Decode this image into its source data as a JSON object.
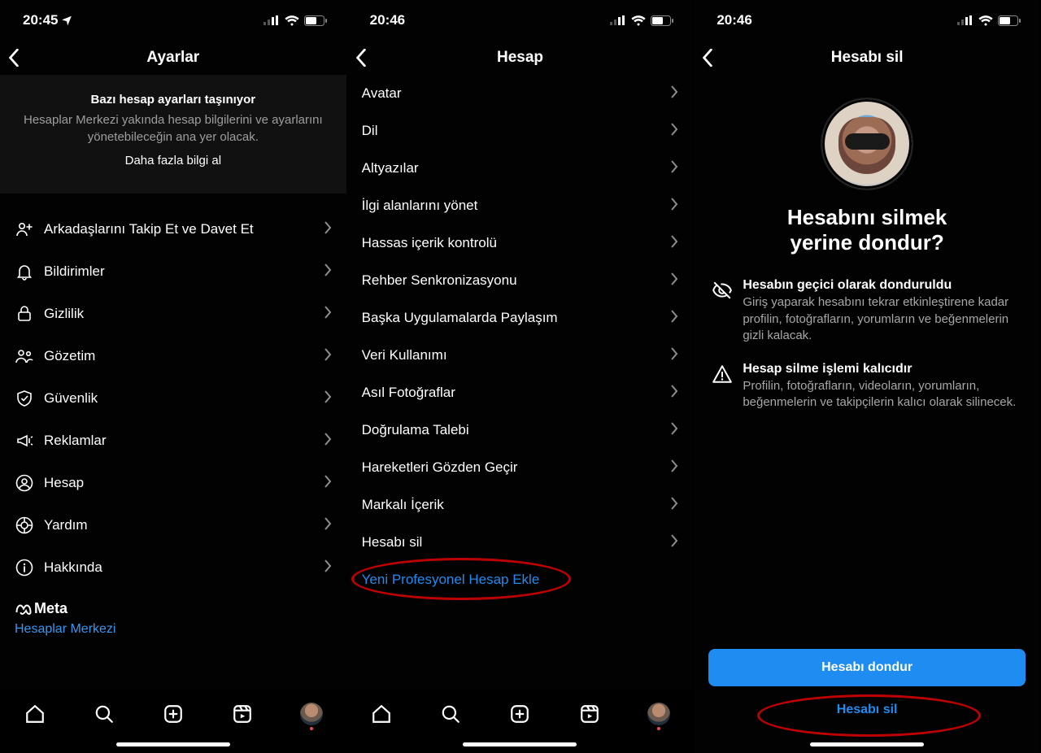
{
  "screen1": {
    "status": {
      "time": "20:45"
    },
    "title": "Ayarlar",
    "banner": {
      "title": "Bazı hesap ayarları taşınıyor",
      "sub": "Hesaplar Merkezi yakında hesap bilgilerini ve ayarlarını yönetebileceğin ana yer olacak.",
      "link": "Daha fazla bilgi al"
    },
    "items": [
      {
        "icon": "user-plus",
        "label": "Arkadaşlarını Takip Et ve Davet Et"
      },
      {
        "icon": "bell",
        "label": "Bildirimler"
      },
      {
        "icon": "lock",
        "label": "Gizlilik"
      },
      {
        "icon": "people",
        "label": "Gözetim"
      },
      {
        "icon": "shield",
        "label": "Güvenlik"
      },
      {
        "icon": "megaphone",
        "label": "Reklamlar"
      },
      {
        "icon": "account",
        "label": "Hesap"
      },
      {
        "icon": "help",
        "label": "Yardım"
      },
      {
        "icon": "info",
        "label": "Hakkında"
      }
    ],
    "footer": {
      "brand": "Meta",
      "accounts_center": "Hesaplar Merkezi"
    }
  },
  "screen2": {
    "status": {
      "time": "20:46"
    },
    "title": "Hesap",
    "items": [
      "Avatar",
      "Dil",
      "Altyazılar",
      "İlgi alanlarını yönet",
      "Hassas içerik kontrolü",
      "Rehber Senkronizasyonu",
      "Başka Uygulamalarda Paylaşım",
      "Veri Kullanımı",
      "Asıl Fotoğraflar",
      "Doğrulama Talebi",
      "Hareketleri Gözden Geçir",
      "Markalı İçerik",
      "Hesabı sil"
    ],
    "add_pro": "Yeni Profesyonel Hesap Ekle"
  },
  "screen3": {
    "status": {
      "time": "20:46"
    },
    "title": "Hesabı sil",
    "headline_line1": "Hesabını silmek",
    "headline_line2": "yerine dondur?",
    "info1": {
      "title": "Hesabın geçici olarak donduruldu",
      "desc": "Giriş yaparak hesabını tekrar etkinleştirene kadar profilin, fotoğrafların, yorumların ve beğenmelerin gizli kalacak."
    },
    "info2": {
      "title": "Hesap silme işlemi kalıcıdır",
      "desc": "Profilin, fotoğrafların, videoların, yorumların, beğenmelerin ve takipçilerin kalıcı olarak silinecek."
    },
    "primary": "Hesabı dondur",
    "destructive": "Hesabı sil"
  }
}
